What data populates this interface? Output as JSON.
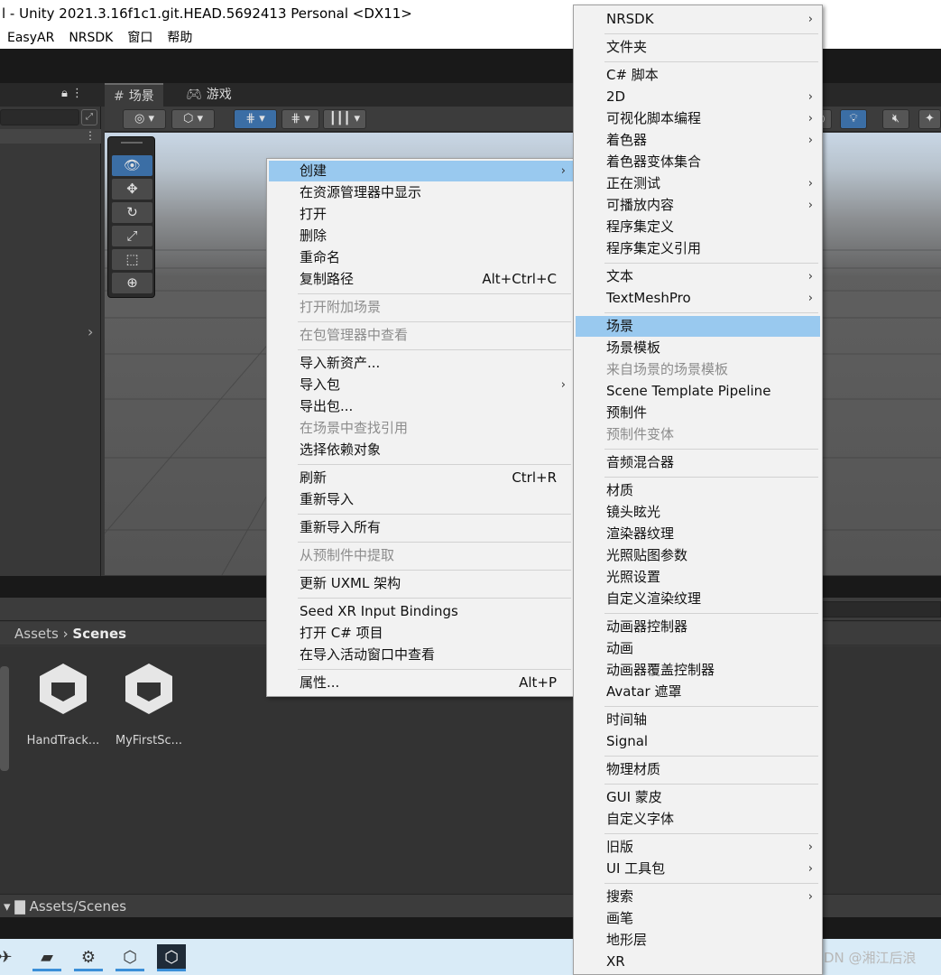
{
  "window": {
    "title": "l - Unity 2021.3.16f1c1.git.HEAD.5692413 Personal <DX11>"
  },
  "menubar": [
    "EasyAR",
    "NRSDK",
    "窗口",
    "帮助"
  ],
  "tabs": {
    "scene": "场景",
    "game": "游戏"
  },
  "icons": {
    "scene_tab": "grid-icon",
    "game_tab": "gamepad-icon",
    "lock": "lock-icon",
    "more": "kebab-menu-icon"
  },
  "gizmo_tools": [
    "view-tool-icon",
    "move-tool-icon",
    "rotate-tool-icon",
    "scale-tool-icon",
    "rect-tool-icon",
    "transform-tool-icon"
  ],
  "project": {
    "breadcrumb_root": "Assets",
    "breadcrumb_current": "Scenes",
    "assets": [
      {
        "name": "HandTrack..."
      },
      {
        "name": "MyFirstSc..."
      }
    ],
    "footer_path": "Assets/Scenes"
  },
  "context_menu": {
    "items": [
      {
        "label": "创建",
        "highlight": true,
        "submenu": true
      },
      {
        "label": "在资源管理器中显示"
      },
      {
        "label": "打开"
      },
      {
        "label": "删除"
      },
      {
        "label": "重命名"
      },
      {
        "label": "复制路径",
        "shortcut": "Alt+Ctrl+C"
      },
      {
        "label": "打开附加场景",
        "disabled": true
      },
      {
        "label": "在包管理器中查看",
        "disabled": true
      },
      {
        "label": "导入新资产..."
      },
      {
        "label": "导入包",
        "submenu": true
      },
      {
        "label": "导出包..."
      },
      {
        "label": "在场景中查找引用",
        "disabled": true
      },
      {
        "label": "选择依赖对象"
      },
      {
        "label": "刷新",
        "shortcut": "Ctrl+R"
      },
      {
        "label": "重新导入"
      },
      {
        "label": "重新导入所有"
      },
      {
        "label": "从预制件中提取",
        "disabled": true
      },
      {
        "label": "更新 UXML 架构"
      },
      {
        "label": "Seed XR Input Bindings"
      },
      {
        "label": "打开 C# 项目"
      },
      {
        "label": "在导入活动窗口中查看"
      },
      {
        "label": "属性...",
        "shortcut": "Alt+P"
      }
    ]
  },
  "create_submenu": {
    "items": [
      {
        "label": "NRSDK",
        "submenu": true
      },
      {
        "label": "文件夹"
      },
      {
        "label": "C# 脚本"
      },
      {
        "label": "2D",
        "submenu": true
      },
      {
        "label": "可视化脚本编程",
        "submenu": true
      },
      {
        "label": "着色器",
        "submenu": true
      },
      {
        "label": "着色器变体集合"
      },
      {
        "label": "正在测试",
        "submenu": true
      },
      {
        "label": "可播放内容",
        "submenu": true
      },
      {
        "label": "程序集定义"
      },
      {
        "label": "程序集定义引用"
      },
      {
        "label": "文本",
        "submenu": true
      },
      {
        "label": "TextMeshPro",
        "submenu": true
      },
      {
        "label": "场景",
        "highlight": true
      },
      {
        "label": "场景模板"
      },
      {
        "label": "来自场景的场景模板",
        "disabled": true
      },
      {
        "label": "Scene Template Pipeline"
      },
      {
        "label": "预制件"
      },
      {
        "label": "预制件变体",
        "disabled": true
      },
      {
        "label": "音频混合器"
      },
      {
        "label": "材质"
      },
      {
        "label": "镜头眩光"
      },
      {
        "label": "渲染器纹理"
      },
      {
        "label": "光照贴图参数"
      },
      {
        "label": "光照设置"
      },
      {
        "label": "自定义渲染纹理"
      },
      {
        "label": "动画器控制器"
      },
      {
        "label": "动画"
      },
      {
        "label": "动画器覆盖控制器"
      },
      {
        "label": "Avatar 遮罩"
      },
      {
        "label": "时间轴"
      },
      {
        "label": "Signal"
      },
      {
        "label": "物理材质"
      },
      {
        "label": "GUI 蒙皮"
      },
      {
        "label": "自定义字体"
      },
      {
        "label": "旧版",
        "submenu": true
      },
      {
        "label": "UI 工具包",
        "submenu": true
      },
      {
        "label": "搜索",
        "submenu": true
      },
      {
        "label": "画笔"
      },
      {
        "label": "地形层"
      },
      {
        "label": "XR"
      }
    ]
  },
  "watermark": "CSDN @湘江后浪",
  "colors": {
    "highlight": "#99c9ef",
    "editor_bg": "#383838",
    "accent": "#3b6ea5"
  }
}
